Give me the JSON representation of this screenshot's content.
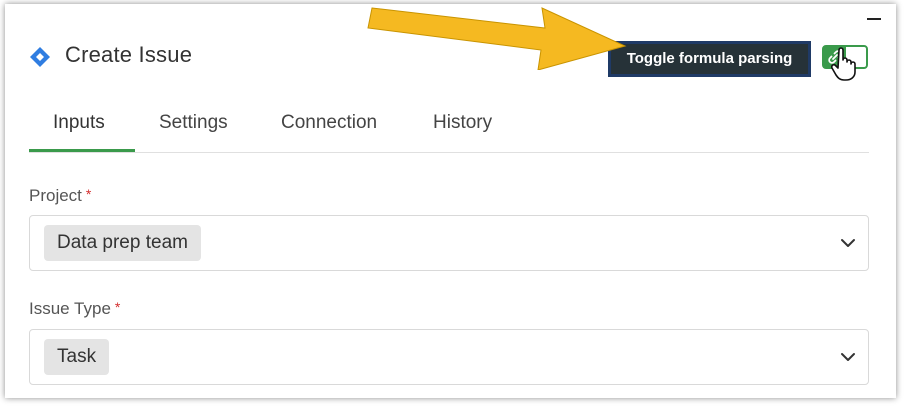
{
  "window": {
    "title": "Create Issue"
  },
  "tooltip": {
    "text": "Toggle formula parsing"
  },
  "tabs": [
    {
      "label": "Inputs",
      "active": true
    },
    {
      "label": "Settings",
      "active": false
    },
    {
      "label": "Connection",
      "active": false
    },
    {
      "label": "History",
      "active": false
    }
  ],
  "fields": {
    "project": {
      "label": "Project",
      "required_mark": "*",
      "value": "Data prep team"
    },
    "issue_type": {
      "label": "Issue Type",
      "required_mark": "*",
      "value": "Task"
    }
  },
  "toggle": {
    "state": "on"
  },
  "colors": {
    "accent": "#3a9a4b",
    "app_icon": "#2f7de1",
    "tooltip_bg": "#263238",
    "required": "#d32f2f",
    "arrow": "#f5b921"
  },
  "icons": {
    "app": "jira-diamond-icon",
    "toggle": "link-icon",
    "minimize": "minimize-icon",
    "chevron": "chevron-down-icon",
    "cursor": "hand-pointer-icon",
    "arrow": "annotation-arrow"
  }
}
